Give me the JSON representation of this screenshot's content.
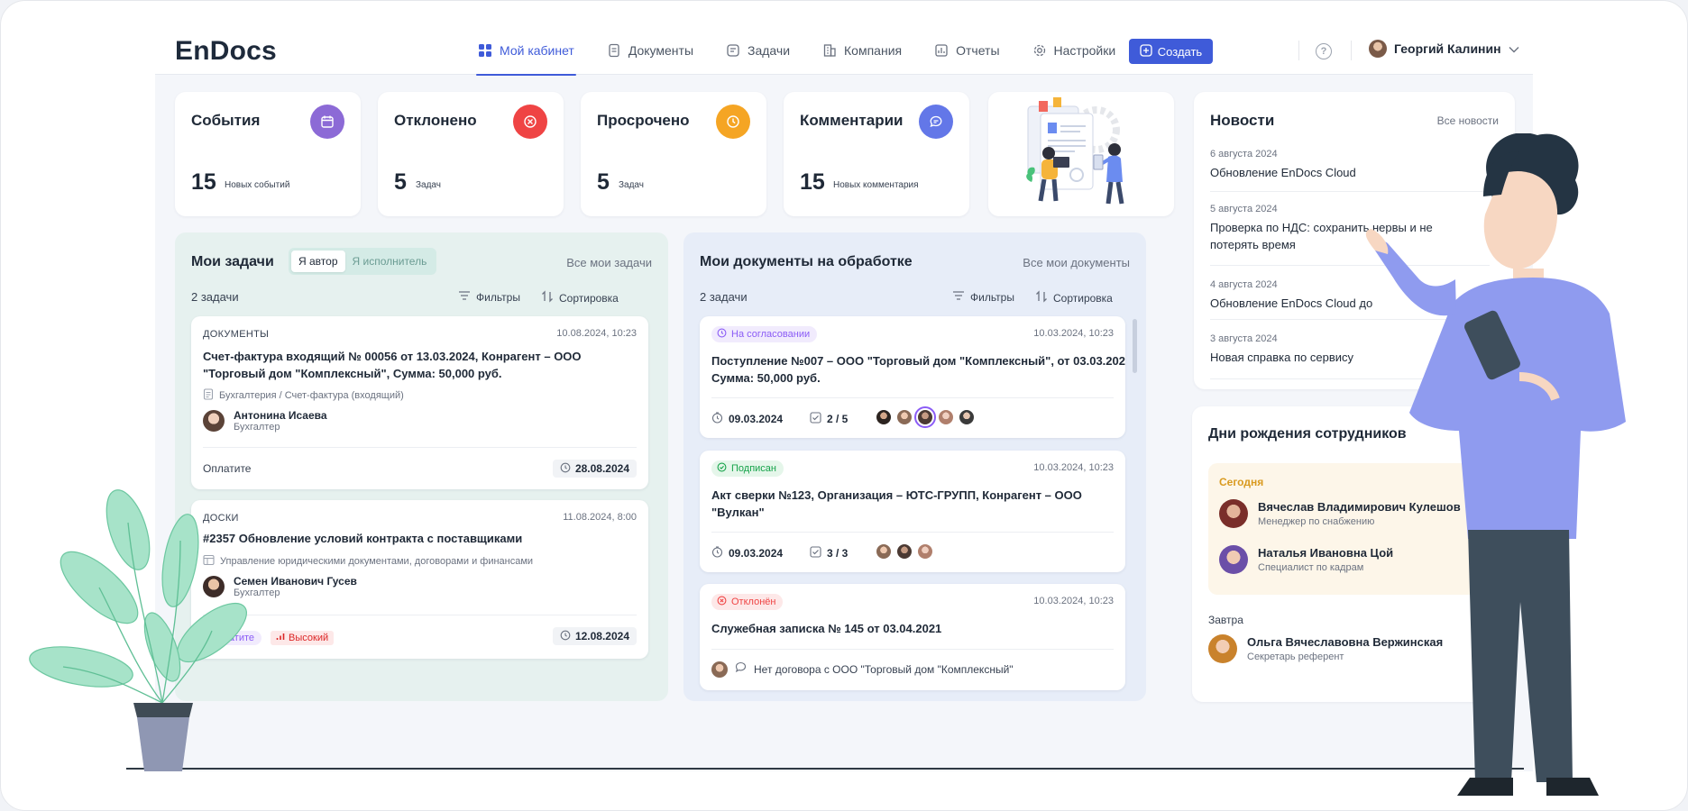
{
  "app": {
    "logo": "EnDocs"
  },
  "nav": {
    "items": [
      {
        "label": "Мой кабинет",
        "icon": "dashboard-icon",
        "active": true
      },
      {
        "label": "Документы",
        "icon": "document-icon"
      },
      {
        "label": "Задачи",
        "icon": "tasks-icon"
      },
      {
        "label": "Компания",
        "icon": "building-icon"
      },
      {
        "label": "Отчеты",
        "icon": "chart-icon"
      },
      {
        "label": "Настройки",
        "icon": "gear-icon"
      }
    ],
    "create_label": "Создать",
    "user_name": "Георгий Калинин"
  },
  "stats": [
    {
      "title": "События",
      "count": "15",
      "sub": "Новых событий",
      "color": "#8c6ad6"
    },
    {
      "title": "Отклонено",
      "count": "5",
      "sub": "Задач",
      "color": "#ef4444"
    },
    {
      "title": "Просрочено",
      "count": "5",
      "sub": "Задач",
      "color": "#f5a524"
    },
    {
      "title": "Комментарии",
      "count": "15",
      "sub": "Новых комментария",
      "color": "#6377e8"
    }
  ],
  "tasks": {
    "title": "Мои задачи",
    "seg_author": "Я автор",
    "seg_executor": "Я исполнитель",
    "all_link": "Все мои задачи",
    "count": "2 задачи",
    "filters": "Фильтры",
    "sort": "Сортировка",
    "cards": [
      {
        "category": "ДОКУМЕНТЫ",
        "date": "10.08.2024, 10:23",
        "title_line1": "Счет-фактура входящий № 00056 от 13.03.2024, Конрагент – ООО",
        "title_line2": "\"Торговый дом \"Комплексный\", Сумма: 50,000 руб.",
        "path": "Бухгалтерия / Счет-фактура (входящий)",
        "person": "Антонина Исаева",
        "role": "Бухгалтер",
        "footer": "Оплатите",
        "due": "28.08.2024"
      },
      {
        "category": "ДОСКИ",
        "date": "11.08.2024, 8:00",
        "title_line1": "#2357 Обновление условий контракта с поставщиками",
        "path": "Управление юридическими документами, договорами и финансами",
        "person": "Семен Иванович Гусев",
        "role": "Бухгалтер",
        "footer": "Оплатите",
        "priority": "Высокий",
        "due": "12.08.2024"
      }
    ]
  },
  "docs": {
    "title": "Мои документы на обработке",
    "all_link": "Все мои документы",
    "count": "2 задачи",
    "filters": "Фильтры",
    "sort": "Сортировка",
    "cards": [
      {
        "status": "На согласовании",
        "status_color": "#8b5cf6",
        "date": "10.03.2024, 10:23",
        "title_line1": "Поступление №007 – ООО \"Торговый дом \"Комплексный\", от 03.03.202",
        "title_line2": "Сумма: 50,000 руб.",
        "deadline": "09.03.2024",
        "checks": "2 / 5"
      },
      {
        "status": "Подписан",
        "status_color": "#16a34a",
        "date": "10.03.2024, 10:23",
        "title_line1": "Акт сверки №123, Организация – ЮТС-ГРУПП, Конрагент – ООО",
        "title_line2": "\"Вулкан\"",
        "deadline": "09.03.2024",
        "checks": "3 / 3"
      },
      {
        "status": "Отклонён",
        "status_color": "#ef4444",
        "date": "10.03.2024, 10:23",
        "title_line1": "Служебная записка  № 145 от 03.04.2021",
        "comment": "Нет договора с ООО \"Торговый дом \"Комплексный\""
      }
    ]
  },
  "news": {
    "title": "Новости",
    "all_link": "Все новости",
    "items": [
      {
        "date": "6 августа 2024",
        "text": "Обновление EnDocs Cloud"
      },
      {
        "date": "5 августа 2024",
        "text": "Проверка по НДС: сохранить нервы и не потерять время"
      },
      {
        "date": "4 августа 2024",
        "text": "Обновление EnDocs Cloud до"
      },
      {
        "date": "3 августа 2024",
        "text": "Новая справка по сервису"
      }
    ]
  },
  "birthdays": {
    "title": "Дни рождения сотрудников",
    "today_label": "Сегодня",
    "today": [
      {
        "name": "Вячеслав Владимирович Кулешов",
        "role": "Менеджер по снабжению"
      },
      {
        "name": "Наталья Ивановна Цой",
        "role": "Специалист по кадрам"
      }
    ],
    "tomorrow_label": "Завтра",
    "tomorrow": [
      {
        "name": "Ольга Вячеславовна Вержинская",
        "role": "Секретарь референт"
      }
    ]
  }
}
